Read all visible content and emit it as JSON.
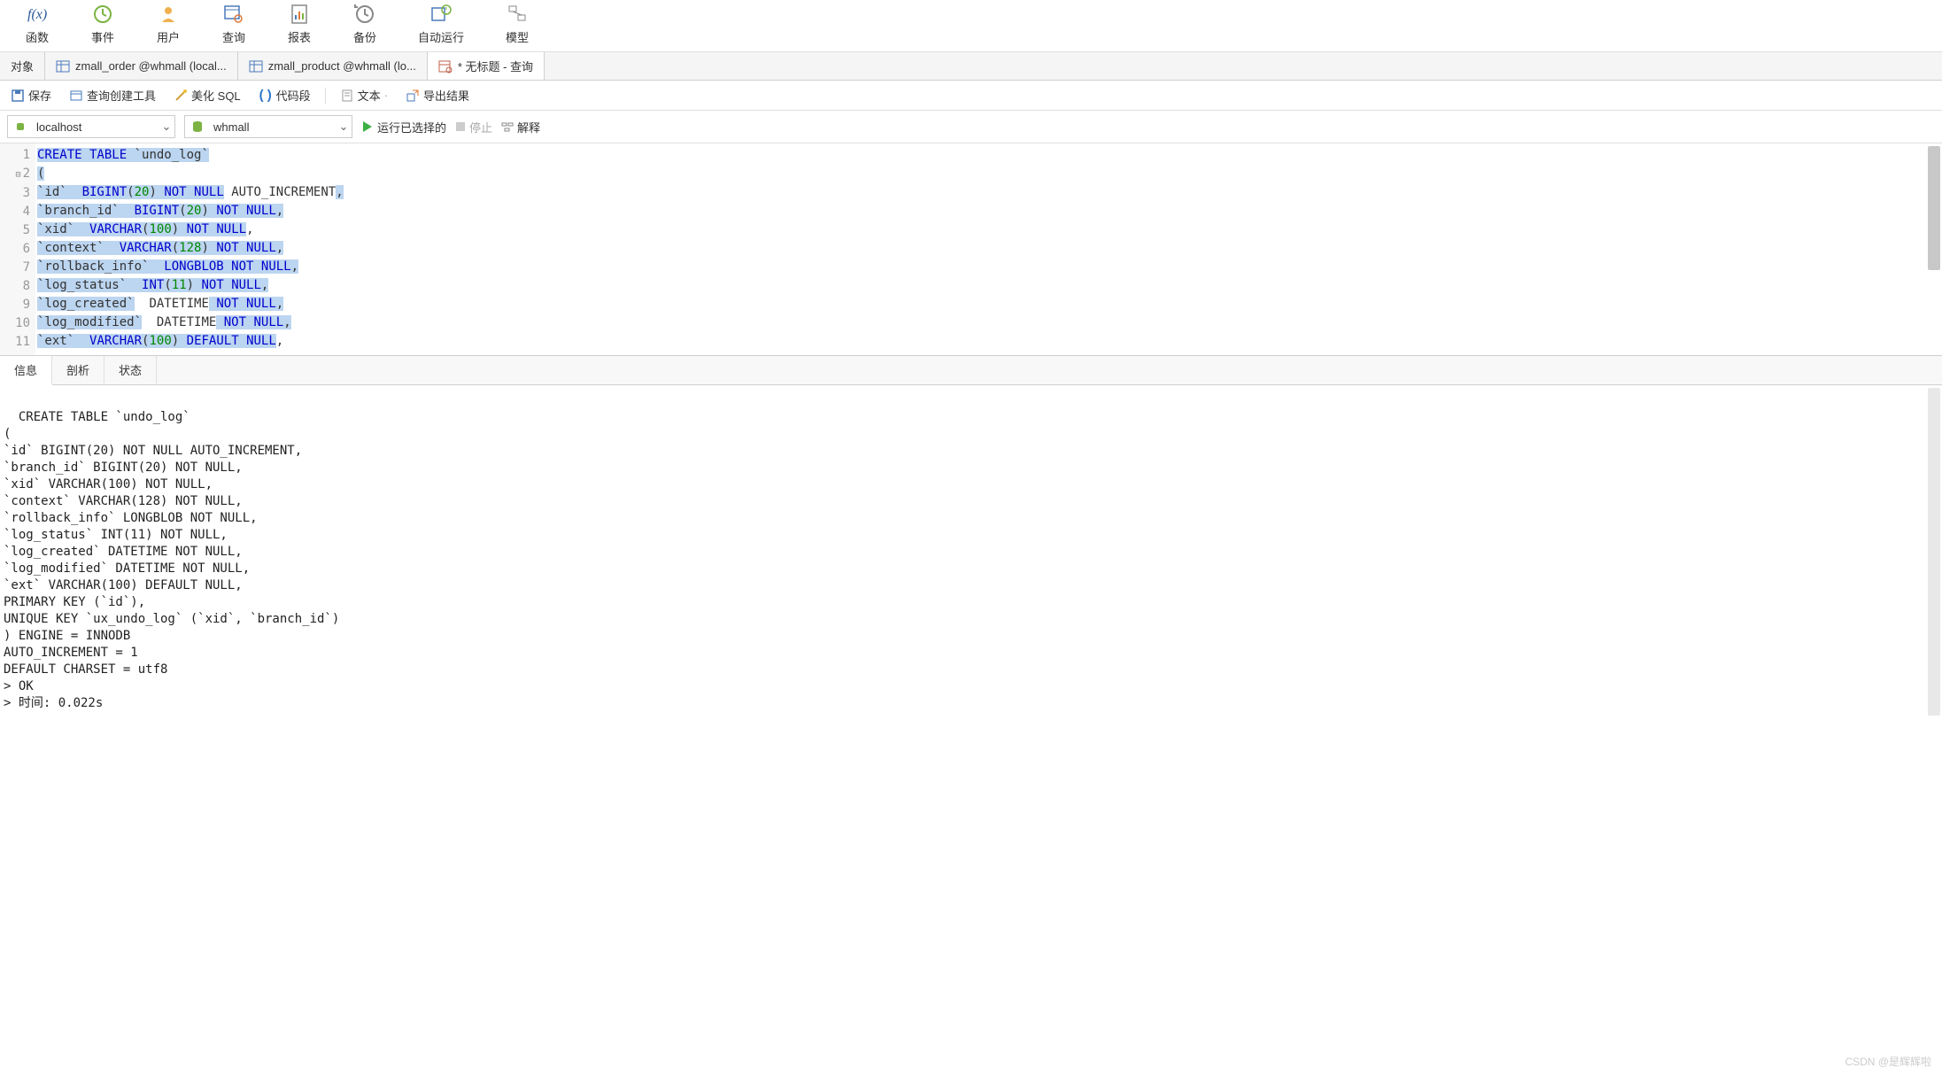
{
  "toolbar": [
    {
      "name": "func",
      "label": "函数",
      "icon": "fx"
    },
    {
      "name": "event",
      "label": "事件",
      "icon": "clock"
    },
    {
      "name": "user",
      "label": "用户",
      "icon": "user"
    },
    {
      "name": "query",
      "label": "查询",
      "icon": "table-search"
    },
    {
      "name": "report",
      "label": "报表",
      "icon": "report"
    },
    {
      "name": "backup",
      "label": "备份",
      "icon": "backup"
    },
    {
      "name": "autorun",
      "label": "自动运行",
      "icon": "autorun"
    },
    {
      "name": "model",
      "label": "模型",
      "icon": "model"
    }
  ],
  "tabs": [
    {
      "name": "object",
      "label": "对象",
      "icon": "",
      "active": false
    },
    {
      "name": "tab1",
      "label": "zmall_order @whmall (local...",
      "icon": "table",
      "active": false
    },
    {
      "name": "tab2",
      "label": "zmall_product @whmall (lo...",
      "icon": "table",
      "active": false
    },
    {
      "name": "tab3",
      "label": "* 无标题 - 查询",
      "icon": "query",
      "active": true
    }
  ],
  "secondary": {
    "save": "保存",
    "query_builder": "查询创建工具",
    "beautify": "美化 SQL",
    "snippet": "代码段",
    "text": "文本",
    "export": "导出结果"
  },
  "connection": {
    "host": "localhost",
    "db": "whmall",
    "run": "运行已选择的",
    "stop": "停止",
    "explain": "解释"
  },
  "editor": {
    "lines": [
      {
        "n": "1",
        "tokens": [
          {
            "t": "CREATE TABLE",
            "c": "kw",
            "hl": true
          },
          {
            "t": " ",
            "hl": true
          },
          {
            "t": "`undo_log`",
            "c": "ident",
            "hl": true
          }
        ]
      },
      {
        "n": "2",
        "fold": true,
        "tokens": [
          {
            "t": "(",
            "c": "sym",
            "hl": true
          }
        ]
      },
      {
        "n": "3",
        "tokens": [
          {
            "t": "`id`",
            "c": "ident",
            "hl": true
          },
          {
            "t": "  ",
            "hl": true
          },
          {
            "t": "BIGINT",
            "c": "ty",
            "hl": true
          },
          {
            "t": "(",
            "c": "sym",
            "hl": true
          },
          {
            "t": "20",
            "c": "num",
            "hl": true
          },
          {
            "t": ")",
            "c": "sym",
            "hl": true
          },
          {
            "t": " ",
            "hl": true
          },
          {
            "t": "NOT NULL",
            "c": "kw",
            "hl": true
          },
          {
            "t": " AUTO_INCREMENT",
            "c": "ident",
            "hl": false
          },
          {
            "t": ",",
            "c": "sym",
            "hl": true
          }
        ]
      },
      {
        "n": "4",
        "tokens": [
          {
            "t": "`branch_id`",
            "c": "ident",
            "hl": true
          },
          {
            "t": "  ",
            "hl": true
          },
          {
            "t": "BIGINT",
            "c": "ty",
            "hl": true
          },
          {
            "t": "(",
            "c": "sym",
            "hl": true
          },
          {
            "t": "20",
            "c": "num",
            "hl": true
          },
          {
            "t": ")",
            "c": "sym",
            "hl": true
          },
          {
            "t": " ",
            "hl": true
          },
          {
            "t": "NOT NULL",
            "c": "kw",
            "hl": true
          },
          {
            "t": ",",
            "c": "sym",
            "hl": true
          }
        ]
      },
      {
        "n": "5",
        "tokens": [
          {
            "t": "`xid`",
            "c": "ident",
            "hl": true
          },
          {
            "t": "  ",
            "hl": true
          },
          {
            "t": "VARCHAR",
            "c": "ty",
            "hl": true
          },
          {
            "t": "(",
            "c": "sym",
            "hl": true
          },
          {
            "t": "100",
            "c": "num",
            "hl": true
          },
          {
            "t": ")",
            "c": "sym",
            "hl": true
          },
          {
            "t": " ",
            "hl": true
          },
          {
            "t": "NOT NULL",
            "c": "kw",
            "hl": true
          },
          {
            "t": ",",
            "c": "sym",
            "hl": false
          }
        ]
      },
      {
        "n": "6",
        "tokens": [
          {
            "t": "`context`",
            "c": "ident",
            "hl": true
          },
          {
            "t": "  ",
            "hl": true
          },
          {
            "t": "VARCHAR",
            "c": "ty",
            "hl": true
          },
          {
            "t": "(",
            "c": "sym",
            "hl": true
          },
          {
            "t": "128",
            "c": "num",
            "hl": true
          },
          {
            "t": ")",
            "c": "sym",
            "hl": true
          },
          {
            "t": " ",
            "hl": true
          },
          {
            "t": "NOT NULL",
            "c": "kw",
            "hl": true
          },
          {
            "t": ",",
            "c": "sym",
            "hl": true
          }
        ]
      },
      {
        "n": "7",
        "tokens": [
          {
            "t": "`rollback_info`",
            "c": "ident",
            "hl": true
          },
          {
            "t": "  ",
            "hl": true
          },
          {
            "t": "LONGBLOB",
            "c": "ty",
            "hl": true
          },
          {
            "t": " ",
            "hl": true
          },
          {
            "t": "NOT NULL",
            "c": "kw",
            "hl": true
          },
          {
            "t": ",",
            "c": "sym",
            "hl": true
          }
        ]
      },
      {
        "n": "8",
        "tokens": [
          {
            "t": "`log_status`",
            "c": "ident",
            "hl": true
          },
          {
            "t": "  ",
            "hl": true
          },
          {
            "t": "INT",
            "c": "ty",
            "hl": true
          },
          {
            "t": "(",
            "c": "sym",
            "hl": true
          },
          {
            "t": "11",
            "c": "num",
            "hl": true
          },
          {
            "t": ")",
            "c": "sym",
            "hl": true
          },
          {
            "t": " ",
            "hl": true
          },
          {
            "t": "NOT NULL",
            "c": "kw",
            "hl": true
          },
          {
            "t": ",",
            "c": "sym",
            "hl": true
          }
        ]
      },
      {
        "n": "9",
        "tokens": [
          {
            "t": "`log_created`",
            "c": "ident",
            "hl": true
          },
          {
            "t": "  ",
            "hl": false
          },
          {
            "t": "DATETIME",
            "c": "ident",
            "hl": false
          },
          {
            "t": " ",
            "hl": true
          },
          {
            "t": "NOT NULL",
            "c": "kw",
            "hl": true
          },
          {
            "t": ",",
            "c": "sym",
            "hl": true
          }
        ]
      },
      {
        "n": "10",
        "tokens": [
          {
            "t": "`log_modified`",
            "c": "ident",
            "hl": true
          },
          {
            "t": "  ",
            "hl": false
          },
          {
            "t": "DATETIME",
            "c": "ident",
            "hl": false
          },
          {
            "t": " ",
            "hl": true
          },
          {
            "t": "NOT NULL",
            "c": "kw",
            "hl": true
          },
          {
            "t": ",",
            "c": "sym",
            "hl": true
          }
        ]
      },
      {
        "n": "11",
        "tokens": [
          {
            "t": "`ext`",
            "c": "ident",
            "hl": true
          },
          {
            "t": "  ",
            "hl": true
          },
          {
            "t": "VARCHAR",
            "c": "ty",
            "hl": true
          },
          {
            "t": "(",
            "c": "sym",
            "hl": true
          },
          {
            "t": "100",
            "c": "num",
            "hl": true
          },
          {
            "t": ")",
            "c": "sym",
            "hl": true
          },
          {
            "t": " ",
            "hl": true
          },
          {
            "t": "DEFAULT NULL",
            "c": "kw",
            "hl": true
          },
          {
            "t": ",",
            "c": "sym",
            "hl": false
          }
        ]
      }
    ]
  },
  "resultTabs": [
    {
      "name": "info",
      "label": "信息",
      "active": true
    },
    {
      "name": "profile",
      "label": "剖析",
      "active": false
    },
    {
      "name": "status",
      "label": "状态",
      "active": false
    }
  ],
  "resultText": "CREATE TABLE `undo_log`\n(\n`id` BIGINT(20) NOT NULL AUTO_INCREMENT,\n`branch_id` BIGINT(20) NOT NULL,\n`xid` VARCHAR(100) NOT NULL,\n`context` VARCHAR(128) NOT NULL,\n`rollback_info` LONGBLOB NOT NULL,\n`log_status` INT(11) NOT NULL,\n`log_created` DATETIME NOT NULL,\n`log_modified` DATETIME NOT NULL,\n`ext` VARCHAR(100) DEFAULT NULL,\nPRIMARY KEY (`id`),\nUNIQUE KEY `ux_undo_log` (`xid`, `branch_id`)\n) ENGINE = INNODB\nAUTO_INCREMENT = 1\nDEFAULT CHARSET = utf8\n> OK\n> 时间: 0.022s",
  "watermark": "CSDN @是辉辉啦"
}
